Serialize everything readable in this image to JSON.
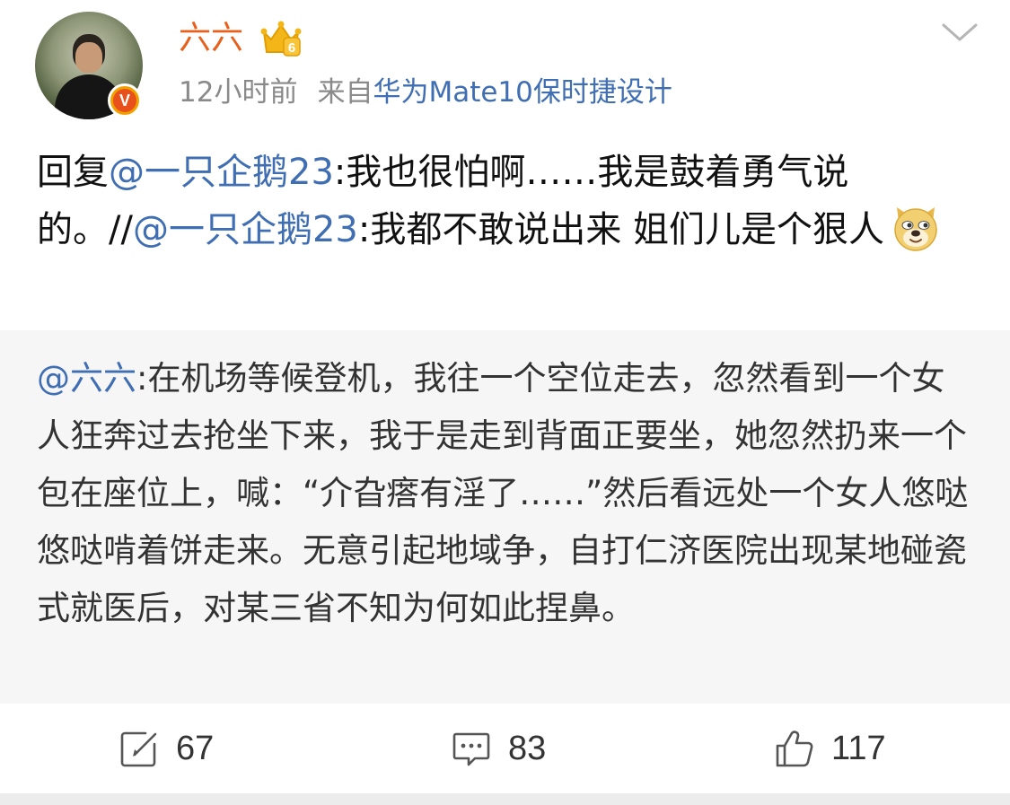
{
  "header": {
    "username": "六六",
    "time": "12小时前",
    "source_prefix": "来自",
    "source": "华为Mate10保时捷设计",
    "verified_badge": "V",
    "vip_level": "6"
  },
  "post": {
    "reply_prefix": "回复",
    "mention1": "@一只企鹅23",
    "text1": ":我也很怕啊……我是鼓着勇气说的。//",
    "mention2": "@一只企鹅23",
    "text2": ":我都不敢说出来 姐们儿是个狠人",
    "emoji": "doge-icon"
  },
  "quote": {
    "mention": "@六六",
    "text": ":在机场等候登机，我往一个空位走去，忽然看到一个女人狂奔过去抢坐下来，我于是走到背面正要坐，她忽然扔来一个包在座位上，喊：“介旮瘩有淫了……”然后看远处一个女人悠哒悠哒啃着饼走来。无意引起地域争，自打仁济医院出现某地碰瓷式就医后，对某三省不知为何如此捏鼻。"
  },
  "actions": {
    "repost_count": "67",
    "comment_count": "83",
    "like_count": "117"
  },
  "colors": {
    "username": "#e8601b",
    "link": "#3f6eb3",
    "meta": "#8a8a8a",
    "quote_bg": "#f6f6f6"
  }
}
